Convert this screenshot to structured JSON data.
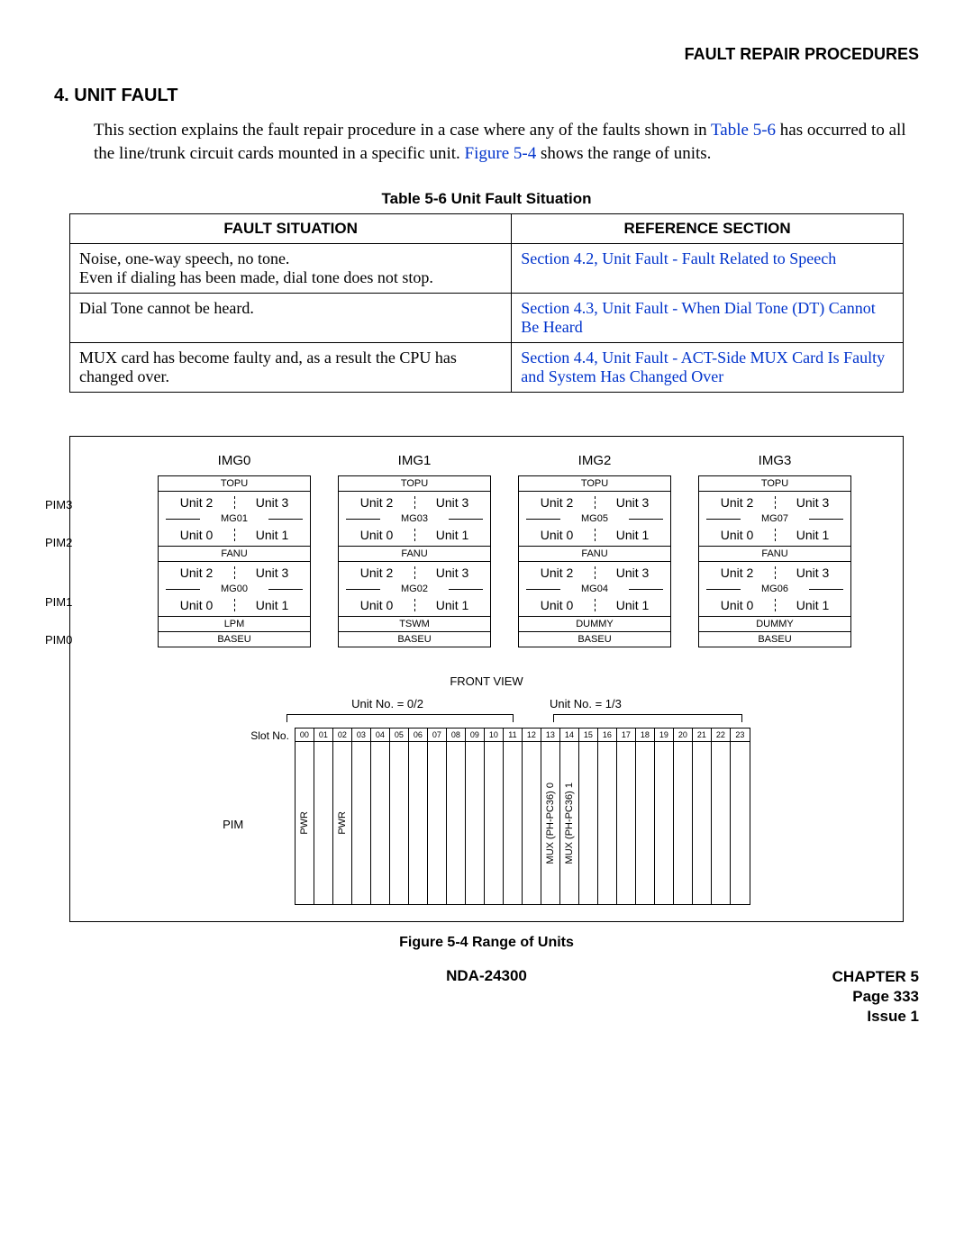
{
  "header_right": "FAULT REPAIR PROCEDURES",
  "section_number": "4.",
  "section_title": "UNIT FAULT",
  "intro_pre": "This section explains the fault repair procedure in a case where any of the faults shown in ",
  "intro_link1": "Table 5-6",
  "intro_mid": " has occurred to all the line/trunk circuit cards mounted in a specific unit. ",
  "intro_link2": "Figure 5-4",
  "intro_post": " shows the range of units.",
  "table_caption": "Table 5-6  Unit Fault Situation",
  "table_headers": [
    "FAULT SITUATION",
    "REFERENCE SECTION"
  ],
  "rows": [
    {
      "sit": "Noise, one-way speech, no tone.\nEven if dialing has been made, dial tone does not stop.",
      "ref": "Section 4.2, Unit Fault - Fault Related to Speech"
    },
    {
      "sit": "Dial Tone cannot be heard.",
      "ref": "Section 4.3, Unit Fault - When Dial Tone (DT) Cannot Be Heard"
    },
    {
      "sit": "MUX card has become faulty and, as a result the CPU has changed over.",
      "ref": "Section 4.4, Unit Fault - ACT-Side MUX Card Is Faulty and System Has Changed Over"
    }
  ],
  "imgcols": [
    {
      "title": "IMG0",
      "mg_top": "MG01",
      "mg_bot": "MG00",
      "bot": "LPM"
    },
    {
      "title": "IMG1",
      "mg_top": "MG03",
      "mg_bot": "MG02",
      "bot": "TSWM"
    },
    {
      "title": "IMG2",
      "mg_top": "MG05",
      "mg_bot": "MG04",
      "bot": "DUMMY"
    },
    {
      "title": "IMG3",
      "mg_top": "MG07",
      "mg_bot": "MG06",
      "bot": "DUMMY"
    }
  ],
  "rack": {
    "topu": "TOPU",
    "fanu": "FANU",
    "baseu": "BASEU",
    "u0": "Unit 0",
    "u1": "Unit 1",
    "u2": "Unit 2",
    "u3": "Unit 3"
  },
  "pims": [
    "PIM3",
    "PIM2",
    "PIM1",
    "PIM0"
  ],
  "front_view": "FRONT VIEW",
  "unitno_left": "Unit No. = 0/2",
  "unitno_right": "Unit No. = 1/3",
  "slot_label": "Slot No.",
  "slots": [
    "00",
    "01",
    "02",
    "03",
    "04",
    "05",
    "06",
    "07",
    "08",
    "09",
    "10",
    "11",
    "12",
    "13",
    "14",
    "15",
    "16",
    "17",
    "18",
    "19",
    "20",
    "21",
    "22",
    "23"
  ],
  "slot_text": {
    "0": "PWR",
    "2": "PWR",
    "13": "MUX (PH-PC36) 0",
    "14": "MUX (PH-PC36) 1"
  },
  "pim_side": "PIM",
  "figure_caption": "Figure 5-4   Range of Units",
  "footer_left": "NDA-24300",
  "footer_right": [
    "CHAPTER 5",
    "Page 333",
    "Issue 1"
  ]
}
